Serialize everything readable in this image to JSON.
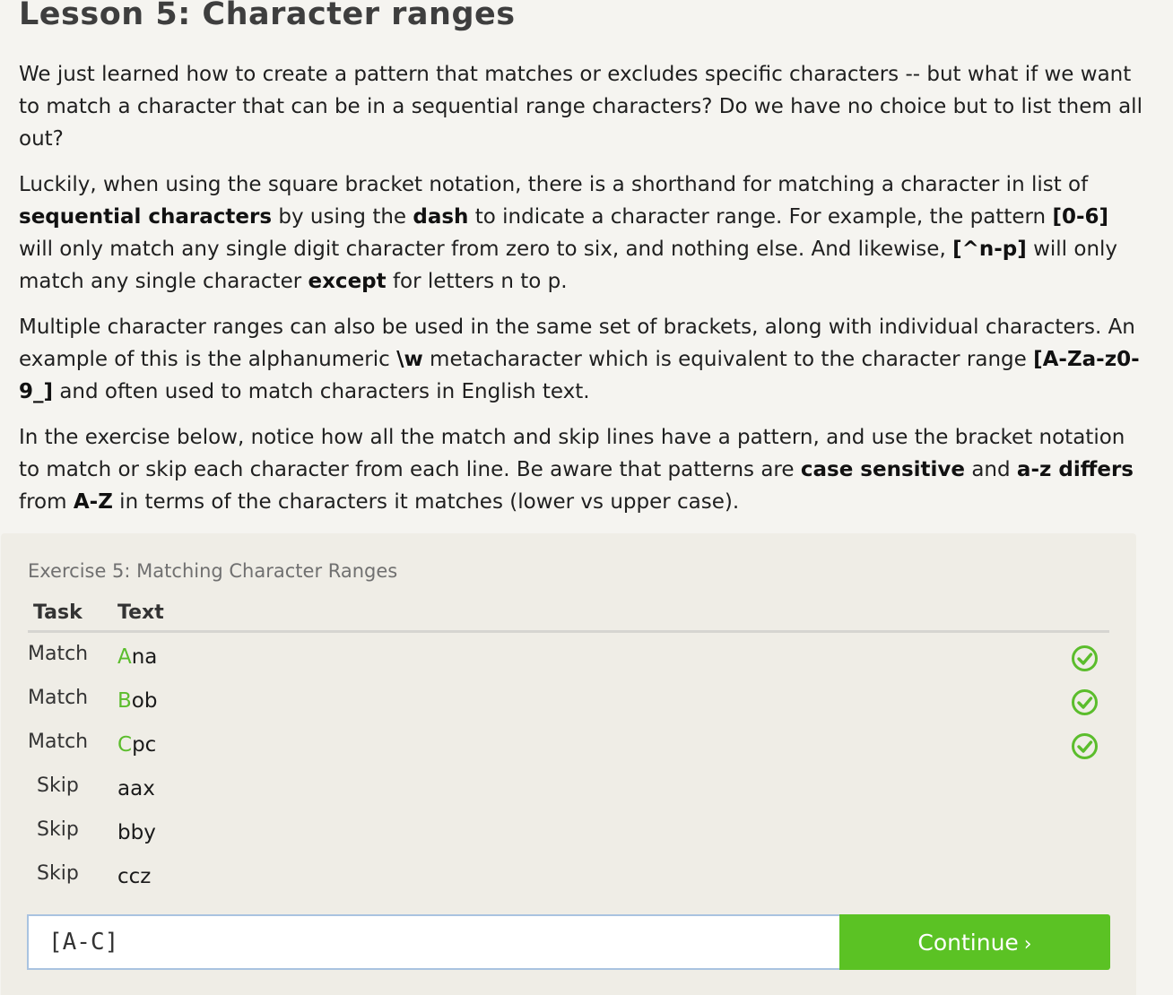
{
  "lesson": {
    "title": "Lesson 5: Character ranges",
    "paragraphs": [
      [
        {
          "t": "We just learned how to create a pattern that matches or excludes specific characters -- but what if we want to match a character that can be in a sequential range characters? Do we have no choice but to list them all out?",
          "b": false
        }
      ],
      [
        {
          "t": "Luckily, when using the square bracket notation, there is a shorthand for matching a character in list of ",
          "b": false
        },
        {
          "t": "sequential characters",
          "b": true
        },
        {
          "t": " by using the ",
          "b": false
        },
        {
          "t": "dash",
          "b": true
        },
        {
          "t": " to indicate a character range. For example, the pattern ",
          "b": false
        },
        {
          "t": "[0-6]",
          "b": true
        },
        {
          "t": " will only match any single digit character from zero to six, and nothing else. And likewise, ",
          "b": false
        },
        {
          "t": "[^n-p]",
          "b": true
        },
        {
          "t": " will only match any single character ",
          "b": false
        },
        {
          "t": "except",
          "b": true
        },
        {
          "t": " for letters n to p.",
          "b": false
        }
      ],
      [
        {
          "t": "Multiple character ranges can also be used in the same set of brackets, along with individual characters. An example of this is the alphanumeric ",
          "b": false
        },
        {
          "t": "\\w",
          "b": true
        },
        {
          "t": " metacharacter which is equivalent to the character range ",
          "b": false
        },
        {
          "t": "[A-Za-z0-9_]",
          "b": true
        },
        {
          "t": " and often used to match characters in English text.",
          "b": false
        }
      ],
      [
        {
          "t": "In the exercise below, notice how all the match and skip lines have a pattern, and use the bracket notation to match or skip each character from each line. Be aware that patterns are ",
          "b": false
        },
        {
          "t": "case sensitive",
          "b": true
        },
        {
          "t": " and ",
          "b": false
        },
        {
          "t": "a-z differs",
          "b": true
        },
        {
          "t": " from ",
          "b": false
        },
        {
          "t": "A-Z",
          "b": true
        },
        {
          "t": " in terms of the characters it matches (lower vs upper case).",
          "b": false
        }
      ]
    ]
  },
  "exercise": {
    "title": "Exercise 5: Matching Character Ranges",
    "headers": {
      "task": "Task",
      "text": "Text"
    },
    "rows": [
      {
        "task": "Match",
        "highlight": "A",
        "rest": "na",
        "passed": true
      },
      {
        "task": "Match",
        "highlight": "B",
        "rest": "ob",
        "passed": true
      },
      {
        "task": "Match",
        "highlight": "C",
        "rest": "pc",
        "passed": true
      },
      {
        "task": "Skip",
        "highlight": "",
        "rest": "aax",
        "passed": false
      },
      {
        "task": "Skip",
        "highlight": "",
        "rest": "bby",
        "passed": false
      },
      {
        "task": "Skip",
        "highlight": "",
        "rest": "ccz",
        "passed": false
      }
    ],
    "input": {
      "value": "[A-C]",
      "placeholder": ""
    },
    "continue_label": "Continue",
    "continue_chevron": "›"
  },
  "colors": {
    "match_highlight": "#5bbd2c",
    "check_green": "#5bbd2c",
    "continue_button": "#5bc224",
    "exercise_bg": "#efede6"
  },
  "icons": {
    "passed": "check-circle-icon",
    "continue": "chevron-right-icon"
  }
}
